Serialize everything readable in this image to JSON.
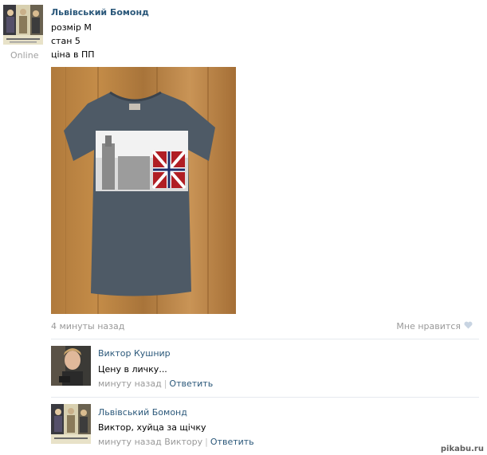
{
  "post": {
    "author": "Львівський Бомонд",
    "status": "Online",
    "lines": [
      "розмір М",
      "стан 5",
      "ціна в ПП"
    ],
    "time": "4 минуты назад",
    "like_label": "Мне нравится"
  },
  "comments": [
    {
      "name": "Виктор Кушнир",
      "text": "Цену в личку...",
      "time": "минуту назад",
      "reply": "Ответить"
    },
    {
      "name": "Львівський Бомонд",
      "text": "Виктор, хуйца за щічку",
      "time": "минуту назад Виктору",
      "reply": "Ответить"
    }
  ],
  "watermark": "pikabu.ru",
  "colors": {
    "link": "#2b587a",
    "muted": "#999999",
    "separator": "#e6e9ee"
  }
}
